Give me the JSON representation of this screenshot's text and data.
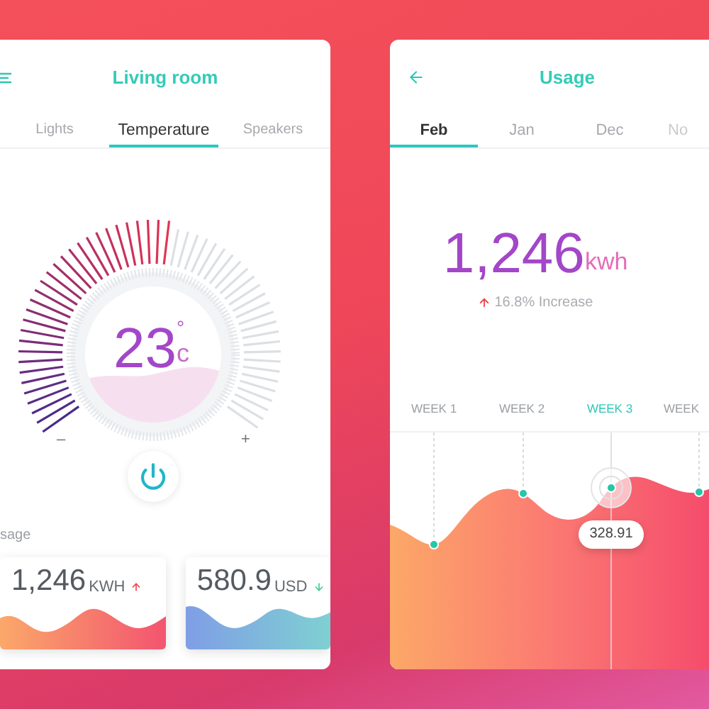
{
  "left_panel": {
    "title": "Living room",
    "tabs": [
      {
        "label": "Lights",
        "selected": false
      },
      {
        "label": "Temperature",
        "selected": true
      },
      {
        "label": "Speakers",
        "selected": false
      }
    ],
    "thermostat": {
      "temperature": "23",
      "degree": "°",
      "unit": "c",
      "minus": "–",
      "plus": "+",
      "power_on": true
    },
    "usage_label": "sage",
    "usage_cards": [
      {
        "kind": "energy",
        "value": "1,246",
        "unit": "KWH",
        "rising": true
      },
      {
        "kind": "cost",
        "value": "580.9",
        "unit": "USD",
        "rising": false
      }
    ]
  },
  "right_panel": {
    "title": "Usage",
    "tabs": [
      {
        "label": "Feb",
        "selected": true
      },
      {
        "label": "Jan",
        "selected": false
      },
      {
        "label": "Dec",
        "selected": false
      },
      {
        "label": "No",
        "selected": false
      }
    ],
    "total": {
      "value": "1,246",
      "unit": "kwh"
    },
    "change": {
      "rising": true,
      "text": "16.8% Increase"
    },
    "weeks": [
      {
        "label": "WEEK 1",
        "selected": false
      },
      {
        "label": "WEEK 2",
        "selected": false
      },
      {
        "label": "WEEK 3",
        "selected": true
      },
      {
        "label": "WEEK",
        "selected": false
      }
    ],
    "tooltip": "328.91"
  }
}
